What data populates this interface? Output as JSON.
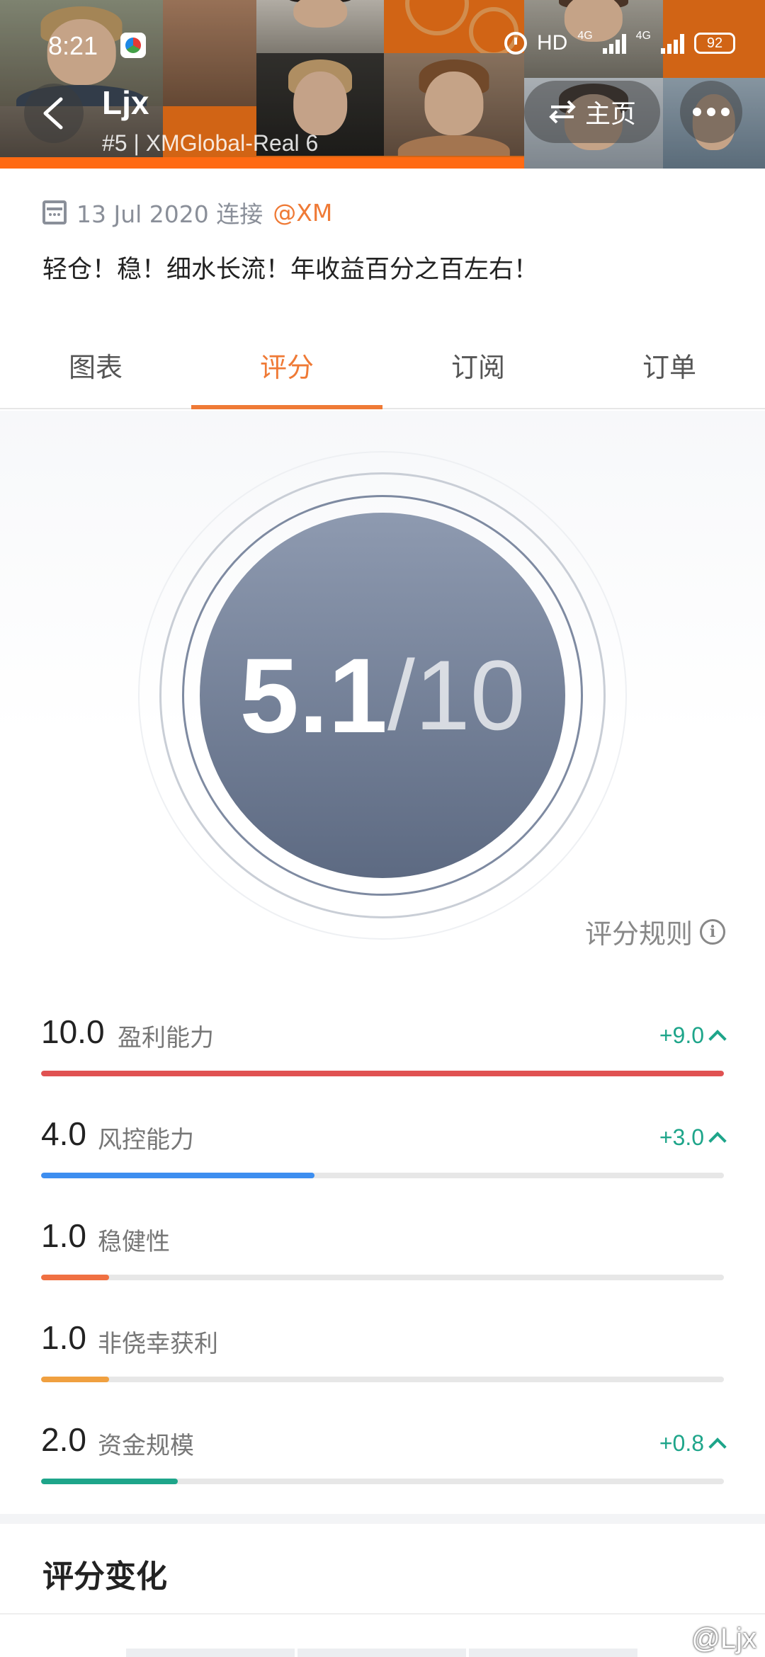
{
  "status_bar": {
    "time": "8:21",
    "hd": "HD",
    "network_1": "4G",
    "network_2": "4G",
    "battery": "92"
  },
  "header": {
    "name": "Ljx",
    "account": "#5 | XMGlobal-Real 6",
    "home_label": "主页",
    "icons": [
      "back-arrow-icon",
      "swap-icon",
      "more-dots-icon"
    ]
  },
  "info": {
    "date_text": "13 Jul 2020 连接",
    "broker": "@XM",
    "description": "轻仓！稳！细水长流！年收益百分之百左右！"
  },
  "tabs": [
    {
      "label": "图表",
      "active": false
    },
    {
      "label": "评分",
      "active": true
    },
    {
      "label": "订阅",
      "active": false
    },
    {
      "label": "订单",
      "active": false
    }
  ],
  "score": {
    "value": "5.1",
    "max": "/10",
    "rules_label": "评分规则"
  },
  "metrics": [
    {
      "score": "10.0",
      "label": "盈利能力",
      "change": "+9.0",
      "fill": 1.0,
      "color": "#e05252"
    },
    {
      "score": "4.0",
      "label": "风控能力",
      "change": "+3.0",
      "fill": 0.4,
      "color": "#3d8ef0"
    },
    {
      "score": "1.0",
      "label": "稳健性",
      "change": "",
      "fill": 0.1,
      "color": "#f07042"
    },
    {
      "score": "1.0",
      "label": "非侥幸获利",
      "change": "",
      "fill": 0.1,
      "color": "#f0a040"
    },
    {
      "score": "2.0",
      "label": "资金规模",
      "change": "+0.8",
      "fill": 0.2,
      "color": "#1ea58a"
    }
  ],
  "section": {
    "title": "评分变化"
  },
  "watermark": "@Ljx",
  "colors": {
    "accent": "#ef7a36",
    "positive": "#1ea58a",
    "score_circle_top": "#8e9ab0",
    "score_circle_bottom": "#5d6a82"
  }
}
